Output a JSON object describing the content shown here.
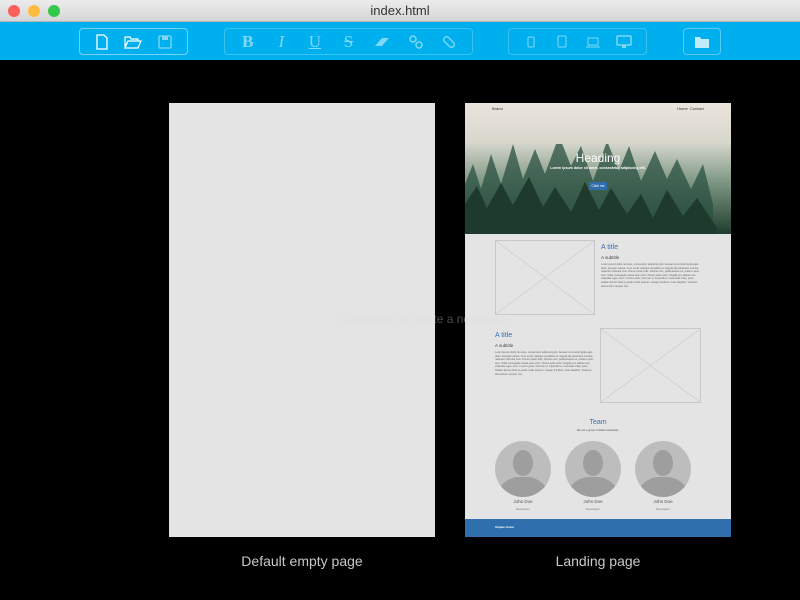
{
  "window": {
    "title": "index.html"
  },
  "toolbar": {
    "file": [
      {
        "icon": "new-file-icon"
      },
      {
        "icon": "open-folder-icon"
      },
      {
        "icon": "save-icon"
      }
    ],
    "format": [
      {
        "label": "B",
        "icon": "bold-icon"
      },
      {
        "label": "I",
        "icon": "italic-icon"
      },
      {
        "label": "U",
        "icon": "underline-icon"
      },
      {
        "label": "S",
        "icon": "strikethrough-icon"
      },
      {
        "icon": "eraser-icon"
      },
      {
        "icon": "link-icon"
      },
      {
        "icon": "unlink-icon"
      }
    ],
    "devices": [
      {
        "icon": "phone-icon"
      },
      {
        "icon": "tablet-icon"
      },
      {
        "icon": "laptop-icon"
      },
      {
        "icon": "desktop-icon"
      }
    ],
    "folder": {
      "icon": "folder-icon"
    },
    "accent": "#00b0ee"
  },
  "hint": "Click here to create a new page",
  "templates": [
    {
      "label": "Default empty page"
    },
    {
      "label": "Landing page",
      "nav": {
        "brand": "Brand",
        "links": [
          "Home",
          "Contact"
        ]
      },
      "hero": {
        "heading": "Heading",
        "text": "Lorem ipsum dolor sit amet, consectetur adipiscing elit.",
        "button": "Click me"
      },
      "features": [
        {
          "title": "A title",
          "subtitle": "A subtitle",
          "text": "Lorem ipsum dolor sit amet, consectetur adipiscing elit. Aenean commodo ligula eget dolor. Aenean massa. Cum sociis natoque penatibus et magnis dis parturient montes, nascetur ridiculus mus. Donec quam felis, ultricies nec, pellentesque eu, pretium quis, sem. Nulla consequat massa quis enim. Donec pede justo, fringilla vel, aliquet nec, vulputate eget, arcu. In enim justo, rhoncus ut, imperdiet a, venenatis vitae, justo. Nullam dictum felis eu pede mollis pretium. Integer tincidunt. Cras dapibus. Vivamus elementum semper nisi."
        },
        {
          "title": "A title",
          "subtitle": "A subtitle",
          "text": "Lorem ipsum dolor sit amet, consectetur adipiscing elit. Aenean commodo ligula eget dolor. Aenean massa. Cum sociis natoque penatibus et magnis dis parturient montes, nascetur ridiculus mus. Donec quam felis, ultricies nec, pellentesque eu, pretium quis, sem. Nulla consequat massa quis enim. Donec pede justo, fringilla vel, aliquet nec, vulputate eget, arcu. In enim justo, rhoncus ut, imperdiet a, venenatis vitae, justo. Nullam dictum felis eu pede mollis pretium. Integer tincidunt. Cras dapibus. Vivamus elementum semper nisi."
        }
      ],
      "team": {
        "title": "Team",
        "subtitle": "We are a group of skilled individuals.",
        "members": [
          {
            "name": "John Doe",
            "role": "Developer"
          },
          {
            "name": "John Doe",
            "role": "Developer"
          },
          {
            "name": "John Doe",
            "role": "Developer"
          }
        ]
      },
      "footer": "Simple footer",
      "footer_color": "#2f6fad"
    }
  ]
}
